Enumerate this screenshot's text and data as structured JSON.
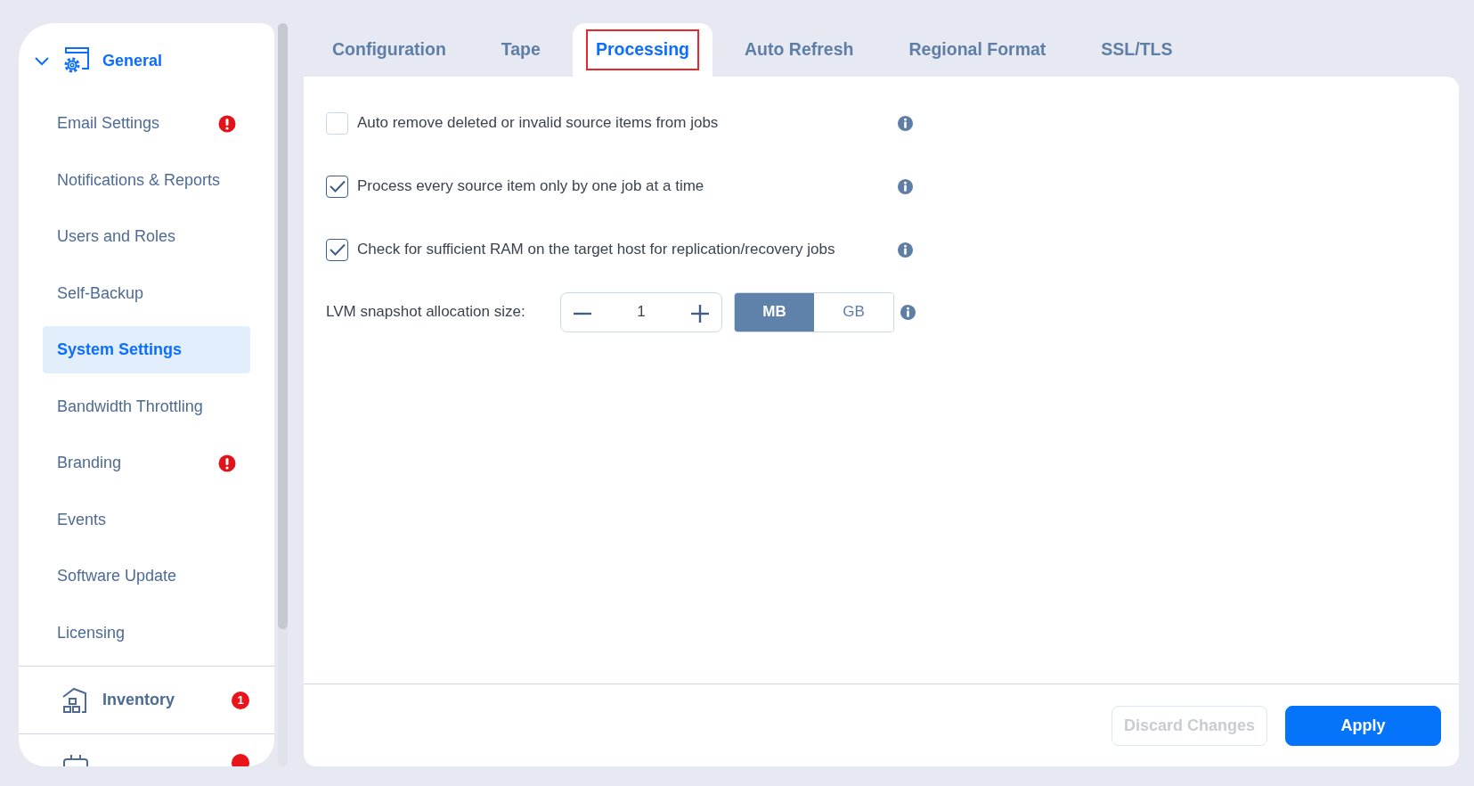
{
  "sidebar": {
    "section": {
      "title": "General",
      "expanded": true
    },
    "items": [
      {
        "label": "Email Settings",
        "selected": false,
        "alert": true
      },
      {
        "label": "Notifications & Reports",
        "selected": false,
        "alert": false
      },
      {
        "label": "Users and Roles",
        "selected": false,
        "alert": false
      },
      {
        "label": "Self-Backup",
        "selected": false,
        "alert": false
      },
      {
        "label": "System Settings",
        "selected": true,
        "alert": false
      },
      {
        "label": "Bandwidth Throttling",
        "selected": false,
        "alert": false
      },
      {
        "label": "Branding",
        "selected": false,
        "alert": true
      },
      {
        "label": "Events",
        "selected": false,
        "alert": false
      },
      {
        "label": "Software Update",
        "selected": false,
        "alert": false
      },
      {
        "label": "Licensing",
        "selected": false,
        "alert": false
      }
    ],
    "sections": [
      {
        "kind": "inventory",
        "title": "Inventory",
        "badge": "1"
      },
      {
        "kind": "transporters",
        "alert": true
      }
    ]
  },
  "tabs": [
    {
      "label": "Configuration",
      "selected": false,
      "highlighted": false
    },
    {
      "label": "Tape",
      "selected": false,
      "highlighted": false
    },
    {
      "label": "Processing",
      "selected": true,
      "highlighted": true
    },
    {
      "label": "Auto Refresh",
      "selected": false,
      "highlighted": false
    },
    {
      "label": "Regional Format",
      "selected": false,
      "highlighted": false
    },
    {
      "label": "SSL/TLS",
      "selected": false,
      "highlighted": false
    }
  ],
  "options": [
    {
      "label": "Auto remove deleted or invalid source items from jobs",
      "checked": false
    },
    {
      "label": "Process every source item only by one job at a time",
      "checked": true
    },
    {
      "label": "Check for sufficient RAM on the target host for replication/recovery jobs",
      "checked": true
    }
  ],
  "lvm": {
    "label": "LVM snapshot allocation size:",
    "value": "1",
    "units": [
      {
        "label": "MB",
        "selected": true
      },
      {
        "label": "GB",
        "selected": false
      }
    ]
  },
  "buttons": [
    {
      "label": "Discard Changes",
      "disabled": true,
      "kind": "secondary"
    },
    {
      "label": "Apply",
      "disabled": false,
      "kind": "primary"
    }
  ]
}
